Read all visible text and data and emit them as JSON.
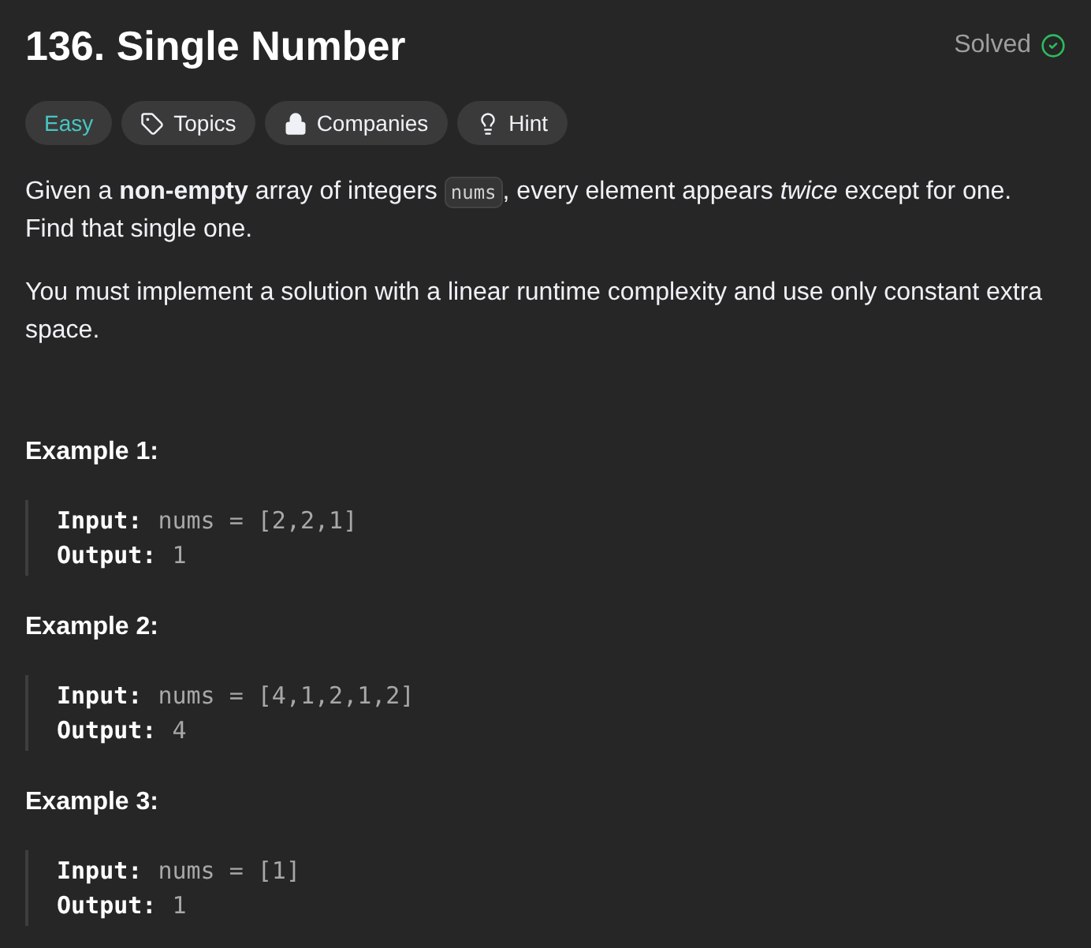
{
  "title": "136. Single Number",
  "status": {
    "label": "Solved",
    "solved": true
  },
  "tags": [
    {
      "kind": "difficulty",
      "label": "Easy"
    },
    {
      "kind": "topics",
      "label": "Topics"
    },
    {
      "kind": "companies",
      "label": "Companies"
    },
    {
      "kind": "hint",
      "label": "Hint"
    }
  ],
  "description": [
    {
      "parts": [
        {
          "kind": "text",
          "text": "Given a **non-empty** array of integers "
        },
        {
          "kind": "code",
          "text": "nums"
        },
        {
          "kind": "text",
          "text": ", every element appears *twice* except for one. Find that single one."
        }
      ]
    },
    {
      "parts": [
        {
          "kind": "text",
          "text": "You must implement a solution with a linear runtime complexity and use only constant extra space."
        }
      ]
    }
  ],
  "examples": [
    {
      "title": "Example 1:",
      "input_label": "Input:",
      "input": "nums = [2,2,1]",
      "output_label": "Output:",
      "output": "1"
    },
    {
      "title": "Example 2:",
      "input_label": "Input:",
      "input": "nums = [4,1,2,1,2]",
      "output_label": "Output:",
      "output": "4"
    },
    {
      "title": "Example 3:",
      "input_label": "Input:",
      "input": "nums = [1]",
      "output_label": "Output:",
      "output": "1"
    }
  ]
}
